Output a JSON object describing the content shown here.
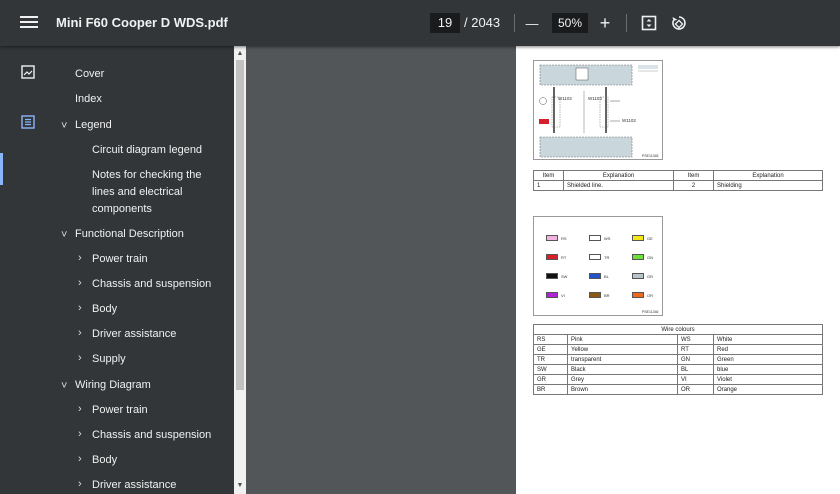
{
  "toolbar": {
    "title": "Mini F60 Cooper D WDS.pdf",
    "page_current": "19",
    "page_total": "/ 2043",
    "zoom_out_glyph": "—",
    "zoom": "50%",
    "zoom_in_glyph": "+"
  },
  "outline": [
    {
      "label": "Cover"
    },
    {
      "label": "Index"
    },
    {
      "label": "Legend",
      "chevron": "˅"
    },
    {
      "label": "Circuit diagram legend"
    },
    {
      "label": "Notes for checking the lines and electrical components"
    },
    {
      "label": "Functional Description",
      "chevron": "˅"
    },
    {
      "label": "Power train",
      "chevron": "›"
    },
    {
      "label": "Chassis and suspension",
      "chevron": "›"
    },
    {
      "label": "Body",
      "chevron": "›"
    },
    {
      "label": "Driver assistance",
      "chevron": "›"
    },
    {
      "label": "Supply",
      "chevron": "›"
    },
    {
      "label": "Wiring Diagram",
      "chevron": "˅"
    },
    {
      "label": "Power train",
      "chevron": "›"
    },
    {
      "label": "Chassis and suspension",
      "chevron": "›"
    },
    {
      "label": "Body",
      "chevron": "›"
    },
    {
      "label": "Driver assistance",
      "chevron": "›"
    }
  ],
  "doc": {
    "table1": {
      "headers": [
        "Item",
        "Explanation",
        "Item",
        "Explanation"
      ],
      "row": [
        "1",
        "Shielded line.",
        "2",
        "Shielding"
      ]
    },
    "fig1_labels": [
      "W1102",
      "W1103",
      "W1102"
    ],
    "fig1_code": "PSE11345",
    "fig2_code": "PSE11346",
    "table2": {
      "caption": "Wire colours",
      "rows": [
        [
          "RS",
          "Pink",
          "WS",
          "White"
        ],
        [
          "GE",
          "Yellow",
          "RT",
          "Red"
        ],
        [
          "TR",
          "transparent",
          "GN",
          "Green"
        ],
        [
          "SW",
          "Black",
          "BL",
          "blue"
        ],
        [
          "GR",
          "Grey",
          "VI",
          "Violet"
        ],
        [
          "BR",
          "Brown",
          "OR",
          "Orange"
        ]
      ]
    },
    "swatches": [
      {
        "code": "RS",
        "color": "#f2b3e0"
      },
      {
        "code": "WS",
        "color": "#ffffff"
      },
      {
        "code": "GE",
        "color": "#f5e618"
      },
      {
        "code": "RT",
        "color": "#d8202a"
      },
      {
        "code": "TR",
        "color": "#ffffff"
      },
      {
        "code": "GN",
        "color": "#6ee03c"
      },
      {
        "code": "SW",
        "color": "#111111"
      },
      {
        "code": "BL",
        "color": "#1f55c8"
      },
      {
        "code": "GR",
        "color": "#b9c4c8"
      },
      {
        "code": "VI",
        "color": "#b024d8"
      },
      {
        "code": "BR",
        "color": "#8a5a12"
      },
      {
        "code": "OR",
        "color": "#ec6a1e"
      }
    ]
  }
}
